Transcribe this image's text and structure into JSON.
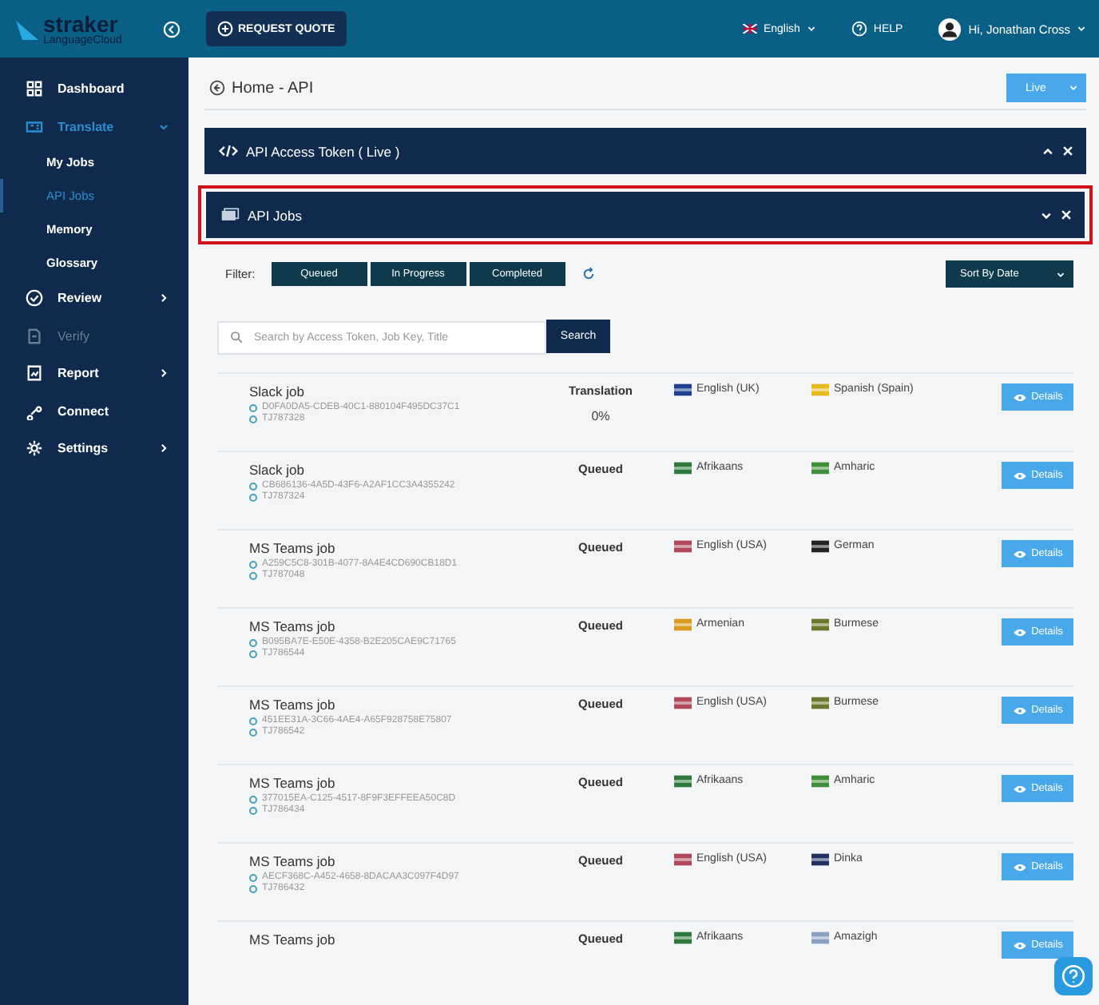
{
  "header": {
    "logo_name": "straker",
    "logo_sub": "LanguageCloud",
    "request_quote": "REQUEST QUOTE",
    "language": "English",
    "help": "HELP",
    "user": "Hi, Jonathan Cross"
  },
  "sidebar": {
    "items": [
      {
        "label": "Dashboard",
        "kind": "link",
        "selected": false,
        "disabled": false
      },
      {
        "label": "Translate",
        "kind": "group",
        "expanded": true,
        "selected": true,
        "disabled": false,
        "children": [
          {
            "label": "My Jobs",
            "selected": false
          },
          {
            "label": "API Jobs",
            "selected": true
          },
          {
            "label": "Memory",
            "selected": false
          },
          {
            "label": "Glossary",
            "selected": false
          }
        ]
      },
      {
        "label": "Review",
        "kind": "group",
        "expanded": false,
        "selected": false,
        "disabled": false
      },
      {
        "label": "Verify",
        "kind": "link",
        "selected": false,
        "disabled": true
      },
      {
        "label": "Report",
        "kind": "group",
        "expanded": false,
        "selected": false,
        "disabled": false
      },
      {
        "label": "Connect",
        "kind": "link",
        "selected": false,
        "disabled": false
      },
      {
        "label": "Settings",
        "kind": "group",
        "expanded": false,
        "selected": false,
        "disabled": false
      }
    ]
  },
  "page": {
    "title": "Home - API",
    "environment": "Live"
  },
  "panels": [
    {
      "title": "API Access Token ( Live )",
      "expanded": false,
      "highlighted": false
    },
    {
      "title": "API Jobs",
      "expanded": true,
      "highlighted": true
    }
  ],
  "filter": {
    "label": "Filter:",
    "options": [
      {
        "label": "Queued",
        "selected": false
      },
      {
        "label": "In Progress",
        "selected": false
      },
      {
        "label": "Completed",
        "selected": false
      }
    ],
    "sort": "Sort By Date"
  },
  "search": {
    "placeholder": "Search by Access Token, Job Key, Title",
    "button": "Search"
  },
  "jobs": [
    {
      "title": "Slack job",
      "token": "D0FA0DA5-CDEB-40C1-880104F495DC37C1",
      "job_id": "TJ787328",
      "status": "Translation",
      "progress": "0%",
      "source": {
        "name": "English (UK)",
        "color": "#1f3f8f"
      },
      "target": {
        "name": "Spanish (Spain)",
        "color": "#e8b81c"
      },
      "action": "Details"
    },
    {
      "title": "Slack job",
      "token": "CB686136-4A5D-43F6-A2AF1CC3A4355242",
      "job_id": "TJ787324",
      "status": "Queued",
      "source": {
        "name": "Afrikaans",
        "color": "#2f7a3a"
      },
      "target": {
        "name": "Amharic",
        "color": "#3f8f3a"
      },
      "action": "Details"
    },
    {
      "title": "MS Teams job",
      "token": "A259C5C8-301B-4077-8A4E4CD690CB18D1",
      "job_id": "TJ787048",
      "status": "Queued",
      "source": {
        "name": "English (USA)",
        "color": "#b0485a"
      },
      "target": {
        "name": "German",
        "color": "#222222"
      },
      "action": "Details"
    },
    {
      "title": "MS Teams job",
      "token": "B095BA7E-E50E-4358-B2E205CAE9C71765",
      "job_id": "TJ786544",
      "status": "Queued",
      "source": {
        "name": "Armenian",
        "color": "#d99a1f"
      },
      "target": {
        "name": "Burmese",
        "color": "#6a7a2a"
      },
      "action": "Details"
    },
    {
      "title": "MS Teams job",
      "token": "451EE31A-3C66-4AE4-A65F928758E75807",
      "job_id": "TJ786542",
      "status": "Queued",
      "source": {
        "name": "English (USA)",
        "color": "#b0485a"
      },
      "target": {
        "name": "Burmese",
        "color": "#6a7a2a"
      },
      "action": "Details"
    },
    {
      "title": "MS Teams job",
      "token": "377015EA-C125-4517-8F9F3EFFEEA50C8D",
      "job_id": "TJ786434",
      "status": "Queued",
      "source": {
        "name": "Afrikaans",
        "color": "#2f7a3a"
      },
      "target": {
        "name": "Amharic",
        "color": "#3f8f3a"
      },
      "action": "Details"
    },
    {
      "title": "MS Teams job",
      "token": "AECF368C-A452-4658-8DACAA3C097F4D97",
      "job_id": "TJ786432",
      "status": "Queued",
      "source": {
        "name": "English (USA)",
        "color": "#b0485a"
      },
      "target": {
        "name": "Dinka",
        "color": "#1f3060"
      },
      "action": "Details"
    },
    {
      "title": "MS Teams job",
      "status": "Queued",
      "source": {
        "name": "Afrikaans",
        "color": "#2f7a3a"
      },
      "target": {
        "name": "Amazigh",
        "color": "#8aa0c0"
      },
      "action": "Details"
    }
  ]
}
